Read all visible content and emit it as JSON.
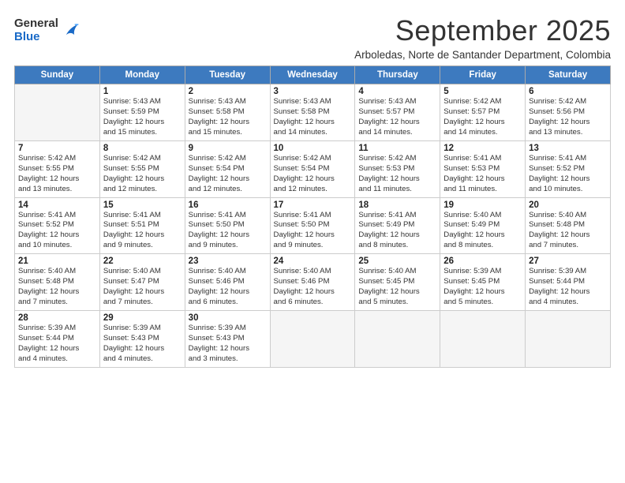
{
  "logo": {
    "general": "General",
    "blue": "Blue"
  },
  "title": "September 2025",
  "subtitle": "Arboledas, Norte de Santander Department, Colombia",
  "days_of_week": [
    "Sunday",
    "Monday",
    "Tuesday",
    "Wednesday",
    "Thursday",
    "Friday",
    "Saturday"
  ],
  "weeks": [
    [
      {
        "day": "",
        "info": ""
      },
      {
        "day": "1",
        "info": "Sunrise: 5:43 AM\nSunset: 5:59 PM\nDaylight: 12 hours\nand 15 minutes."
      },
      {
        "day": "2",
        "info": "Sunrise: 5:43 AM\nSunset: 5:58 PM\nDaylight: 12 hours\nand 15 minutes."
      },
      {
        "day": "3",
        "info": "Sunrise: 5:43 AM\nSunset: 5:58 PM\nDaylight: 12 hours\nand 14 minutes."
      },
      {
        "day": "4",
        "info": "Sunrise: 5:43 AM\nSunset: 5:57 PM\nDaylight: 12 hours\nand 14 minutes."
      },
      {
        "day": "5",
        "info": "Sunrise: 5:42 AM\nSunset: 5:57 PM\nDaylight: 12 hours\nand 14 minutes."
      },
      {
        "day": "6",
        "info": "Sunrise: 5:42 AM\nSunset: 5:56 PM\nDaylight: 12 hours\nand 13 minutes."
      }
    ],
    [
      {
        "day": "7",
        "info": "Sunrise: 5:42 AM\nSunset: 5:55 PM\nDaylight: 12 hours\nand 13 minutes."
      },
      {
        "day": "8",
        "info": "Sunrise: 5:42 AM\nSunset: 5:55 PM\nDaylight: 12 hours\nand 12 minutes."
      },
      {
        "day": "9",
        "info": "Sunrise: 5:42 AM\nSunset: 5:54 PM\nDaylight: 12 hours\nand 12 minutes."
      },
      {
        "day": "10",
        "info": "Sunrise: 5:42 AM\nSunset: 5:54 PM\nDaylight: 12 hours\nand 12 minutes."
      },
      {
        "day": "11",
        "info": "Sunrise: 5:42 AM\nSunset: 5:53 PM\nDaylight: 12 hours\nand 11 minutes."
      },
      {
        "day": "12",
        "info": "Sunrise: 5:41 AM\nSunset: 5:53 PM\nDaylight: 12 hours\nand 11 minutes."
      },
      {
        "day": "13",
        "info": "Sunrise: 5:41 AM\nSunset: 5:52 PM\nDaylight: 12 hours\nand 10 minutes."
      }
    ],
    [
      {
        "day": "14",
        "info": "Sunrise: 5:41 AM\nSunset: 5:52 PM\nDaylight: 12 hours\nand 10 minutes."
      },
      {
        "day": "15",
        "info": "Sunrise: 5:41 AM\nSunset: 5:51 PM\nDaylight: 12 hours\nand 9 minutes."
      },
      {
        "day": "16",
        "info": "Sunrise: 5:41 AM\nSunset: 5:50 PM\nDaylight: 12 hours\nand 9 minutes."
      },
      {
        "day": "17",
        "info": "Sunrise: 5:41 AM\nSunset: 5:50 PM\nDaylight: 12 hours\nand 9 minutes."
      },
      {
        "day": "18",
        "info": "Sunrise: 5:41 AM\nSunset: 5:49 PM\nDaylight: 12 hours\nand 8 minutes."
      },
      {
        "day": "19",
        "info": "Sunrise: 5:40 AM\nSunset: 5:49 PM\nDaylight: 12 hours\nand 8 minutes."
      },
      {
        "day": "20",
        "info": "Sunrise: 5:40 AM\nSunset: 5:48 PM\nDaylight: 12 hours\nand 7 minutes."
      }
    ],
    [
      {
        "day": "21",
        "info": "Sunrise: 5:40 AM\nSunset: 5:48 PM\nDaylight: 12 hours\nand 7 minutes."
      },
      {
        "day": "22",
        "info": "Sunrise: 5:40 AM\nSunset: 5:47 PM\nDaylight: 12 hours\nand 7 minutes."
      },
      {
        "day": "23",
        "info": "Sunrise: 5:40 AM\nSunset: 5:46 PM\nDaylight: 12 hours\nand 6 minutes."
      },
      {
        "day": "24",
        "info": "Sunrise: 5:40 AM\nSunset: 5:46 PM\nDaylight: 12 hours\nand 6 minutes."
      },
      {
        "day": "25",
        "info": "Sunrise: 5:40 AM\nSunset: 5:45 PM\nDaylight: 12 hours\nand 5 minutes."
      },
      {
        "day": "26",
        "info": "Sunrise: 5:39 AM\nSunset: 5:45 PM\nDaylight: 12 hours\nand 5 minutes."
      },
      {
        "day": "27",
        "info": "Sunrise: 5:39 AM\nSunset: 5:44 PM\nDaylight: 12 hours\nand 4 minutes."
      }
    ],
    [
      {
        "day": "28",
        "info": "Sunrise: 5:39 AM\nSunset: 5:44 PM\nDaylight: 12 hours\nand 4 minutes."
      },
      {
        "day": "29",
        "info": "Sunrise: 5:39 AM\nSunset: 5:43 PM\nDaylight: 12 hours\nand 4 minutes."
      },
      {
        "day": "30",
        "info": "Sunrise: 5:39 AM\nSunset: 5:43 PM\nDaylight: 12 hours\nand 3 minutes."
      },
      {
        "day": "",
        "info": ""
      },
      {
        "day": "",
        "info": ""
      },
      {
        "day": "",
        "info": ""
      },
      {
        "day": "",
        "info": ""
      }
    ]
  ]
}
